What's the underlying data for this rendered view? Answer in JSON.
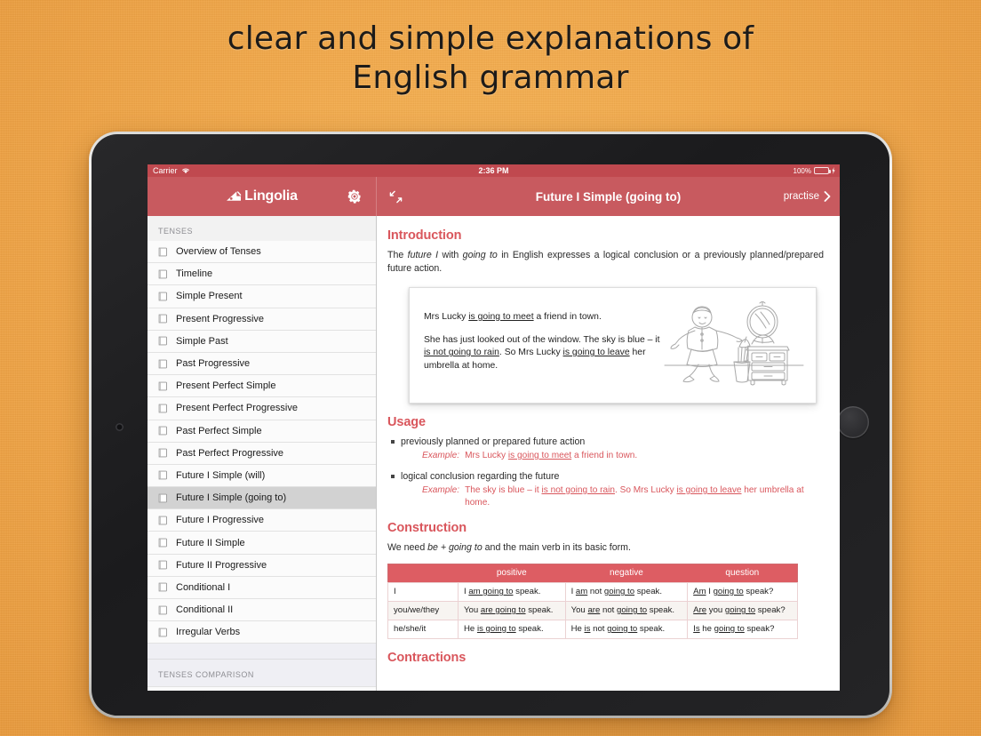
{
  "promo": {
    "line1": "clear and simple explanations of",
    "line2": "English grammar"
  },
  "device": {
    "camera_icon": "front-camera-icon",
    "home_button": "home-button"
  },
  "status_bar": {
    "carrier": "Carrier",
    "wifi_icon": "wifi-icon",
    "time": "2:36 PM",
    "battery_percent": "100%",
    "battery_icon": "battery-full-icon",
    "charging_icon": "charging-bolt-icon"
  },
  "navbar": {
    "logo_mark_icon": "lingolia-logo-icon",
    "logo_text": "Lingolia",
    "settings_icon": "gear-icon",
    "expand_icon": "expand-collapse-arrows-icon",
    "title": "Future I Simple (going to)",
    "practise_label": "practise",
    "practise_chevron_icon": "chevron-right-icon"
  },
  "sidebar": {
    "section_title": "TENSES",
    "items": [
      {
        "label": "Overview of Tenses",
        "icon": "book-icon",
        "selected": false
      },
      {
        "label": "Timeline",
        "icon": "book-icon",
        "selected": false
      },
      {
        "label": "Simple Present",
        "icon": "book-icon",
        "selected": false
      },
      {
        "label": "Present Progressive",
        "icon": "book-icon",
        "selected": false
      },
      {
        "label": "Simple Past",
        "icon": "book-icon",
        "selected": false
      },
      {
        "label": "Past Progressive",
        "icon": "book-icon",
        "selected": false
      },
      {
        "label": "Present Perfect Simple",
        "icon": "book-icon",
        "selected": false
      },
      {
        "label": "Present Perfect Progressive",
        "icon": "book-icon",
        "selected": false
      },
      {
        "label": "Past Perfect Simple",
        "icon": "book-icon",
        "selected": false
      },
      {
        "label": "Past Perfect Progressive",
        "icon": "book-icon",
        "selected": false
      },
      {
        "label": "Future I Simple (will)",
        "icon": "book-icon",
        "selected": false
      },
      {
        "label": "Future I Simple (going to)",
        "icon": "book-icon",
        "selected": true
      },
      {
        "label": "Future I Progressive",
        "icon": "book-icon",
        "selected": false
      },
      {
        "label": "Future II Simple",
        "icon": "book-icon",
        "selected": false
      },
      {
        "label": "Future II Progressive",
        "icon": "book-icon",
        "selected": false
      },
      {
        "label": "Conditional I",
        "icon": "book-icon",
        "selected": false
      },
      {
        "label": "Conditional II",
        "icon": "book-icon",
        "selected": false
      },
      {
        "label": "Irregular Verbs",
        "icon": "book-icon",
        "selected": false
      }
    ],
    "section_title_2": "TENSES COMPARISON"
  },
  "main": {
    "introduction": {
      "heading": "Introduction",
      "paragraph_parts": [
        {
          "text": "The ",
          "style": "normal"
        },
        {
          "text": "future I",
          "style": "italic"
        },
        {
          "text": " with ",
          "style": "normal"
        },
        {
          "text": "going to",
          "style": "italic"
        },
        {
          "text": " in English expresses a logical conclusion or a previously planned/prepared future action.",
          "style": "normal"
        }
      ],
      "paragraph_plain": "The future I with going to in English expresses a logical conclusion or a previously planned/prepared future action."
    },
    "example_box": {
      "illustration_icon": "sketch-woman-dresser-umbrella-illustration",
      "paragraph1": "Mrs Lucky is going to meet a friend in town.",
      "p1_pre": "Mrs Lucky ",
      "p1_underline": "is going to meet",
      "p1_post": " a friend in town.",
      "p2_a": "She has just looked out of the window. The sky is blue – it ",
      "p2_u1": "is not going to rain",
      "p2_b": ". So Mrs Lucky ",
      "p2_u2": "is going to leave",
      "p2_c": " her umbrella at home."
    },
    "usage": {
      "heading": "Usage",
      "items": [
        {
          "point": "previously planned or prepared future action",
          "example_label": "Example:",
          "ex_a": "Mrs Lucky ",
          "ex_u1": "is going to meet",
          "ex_b": " a friend in town.",
          "ex_u2": "",
          "ex_c": ""
        },
        {
          "point": "logical conclusion regarding the future",
          "example_label": "Example:",
          "ex_a": "The sky is blue – it ",
          "ex_u1": "is not going to rain",
          "ex_b": ". So Mrs Lucky ",
          "ex_u2": "is going to leave",
          "ex_c": " her umbrella at home."
        }
      ]
    },
    "construction": {
      "heading": "Construction",
      "intro_a": "We need ",
      "intro_i1": "be + going to",
      "intro_b": " and the main verb in its basic form.",
      "columns": [
        "",
        "positive",
        "negative",
        "question"
      ],
      "rows": [
        {
          "subject": "I",
          "positive": {
            "a": "I ",
            "u1": "am going to",
            "b": " speak.",
            "u2": "",
            "c": ""
          },
          "negative": {
            "a": "I ",
            "u1": "am",
            "b": " not ",
            "u2": "going to",
            "c": " speak."
          },
          "question": {
            "a": "",
            "u1": "Am",
            "b": " I ",
            "u2": "going to",
            "c": " speak?"
          }
        },
        {
          "subject": "you/we/they",
          "positive": {
            "a": "You ",
            "u1": "are going to",
            "b": " speak.",
            "u2": "",
            "c": ""
          },
          "negative": {
            "a": "You ",
            "u1": "are",
            "b": " not ",
            "u2": "going to",
            "c": " speak."
          },
          "question": {
            "a": "",
            "u1": "Are",
            "b": " you ",
            "u2": "going to",
            "c": " speak?"
          }
        },
        {
          "subject": "he/she/it",
          "positive": {
            "a": "He ",
            "u1": "is going to",
            "b": " speak.",
            "u2": "",
            "c": ""
          },
          "negative": {
            "a": "He ",
            "u1": "is",
            "b": " not ",
            "u2": "going to",
            "c": " speak."
          },
          "question": {
            "a": "",
            "u1": "Is",
            "b": " he ",
            "u2": "going to",
            "c": " speak?"
          }
        }
      ]
    },
    "contractions": {
      "heading": "Contractions"
    }
  },
  "colors": {
    "background_orange": "#f3a94a",
    "brand_red": "#c85a5f",
    "heading_red": "#d9565c",
    "table_header_red": "#dd5d63",
    "sidebar_bg": "#efeff4",
    "selected_row": "#d2d2d2",
    "battery_green": "#57e05a"
  }
}
